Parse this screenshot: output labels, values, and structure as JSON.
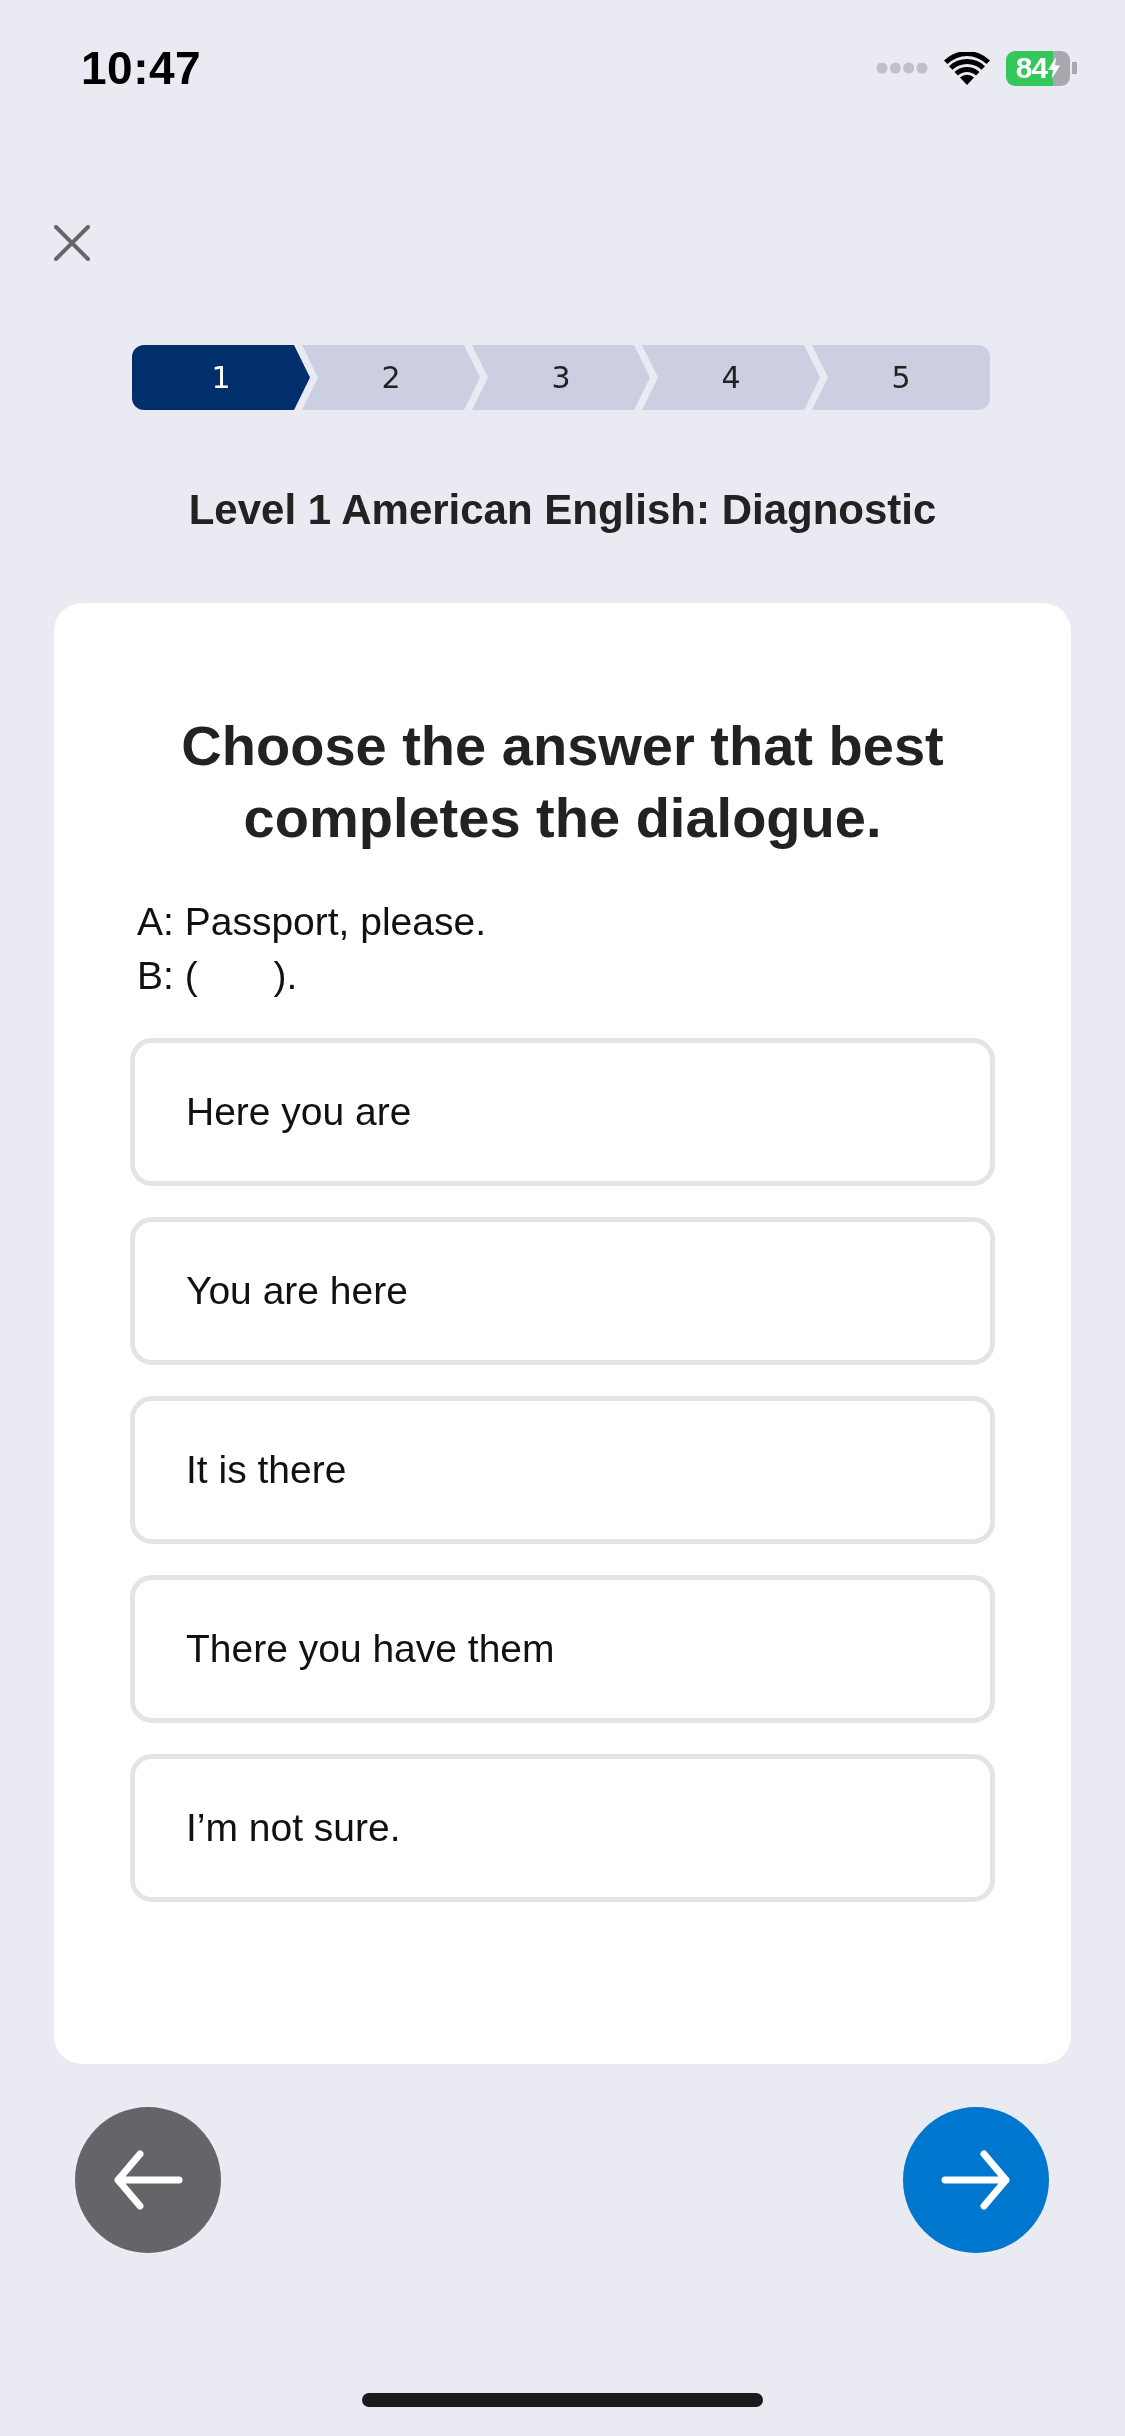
{
  "status_bar": {
    "time": "10:47",
    "battery_percentage": "84"
  },
  "progress_steps": [
    {
      "label": "1",
      "selected": true
    },
    {
      "label": "2",
      "selected": false
    },
    {
      "label": "3",
      "selected": false
    },
    {
      "label": "4",
      "selected": false
    },
    {
      "label": "5",
      "selected": false
    }
  ],
  "title": "Level 1 American English: Diagnostic",
  "question": {
    "prompt": "Choose the answer that best completes the dialogue.",
    "dialogue": [
      "A: Passport, please.",
      "B: (       )."
    ],
    "options": [
      {
        "label": "Here you are",
        "selected": false
      },
      {
        "label": "You are here",
        "selected": false
      },
      {
        "label": "It is there",
        "selected": false
      },
      {
        "label": "There you have them",
        "selected": false
      },
      {
        "label": "I’m not sure.",
        "selected": false
      }
    ]
  }
}
